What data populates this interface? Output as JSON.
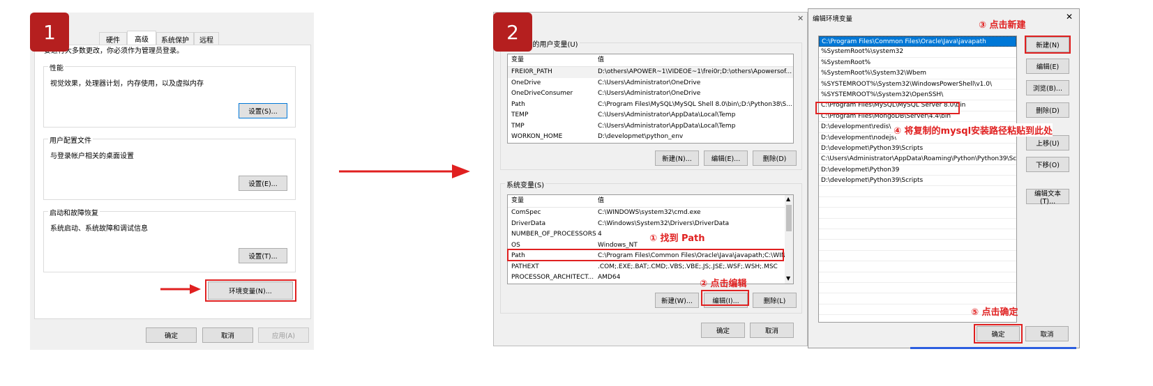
{
  "steps": {
    "step1": "1",
    "step2": "2"
  },
  "panel1": {
    "tabs": [
      "硬件",
      "高级",
      "系统保护",
      "远程"
    ],
    "intro": "要进行大多数更改，你必须作为管理员登录。",
    "performance": {
      "title": "性能",
      "desc": "视觉效果，处理器计划，内存使用，以及虚拟内存",
      "button": "设置(S)..."
    },
    "profile": {
      "title": "用户配置文件",
      "desc": "与登录帐户相关的桌面设置",
      "button": "设置(E)..."
    },
    "startup": {
      "title": "启动和故障恢复",
      "desc": "系统启动、系统故障和调试信息",
      "button": "设置(T)..."
    },
    "env_button": "环境变量(N)...",
    "ok": "确定",
    "cancel": "取消",
    "apply": "应用(A)"
  },
  "panel2": {
    "user_vars_title": "ator 的用户变量(U)",
    "col_var": "变量",
    "col_val": "值",
    "user_vars": [
      {
        "name": "FREI0R_PATH",
        "value": "D:\\others\\APOWER~1\\VIDEOE~1\\frei0r;D:\\others\\Apowersof..."
      },
      {
        "name": "OneDrive",
        "value": "C:\\Users\\Administrator\\OneDrive"
      },
      {
        "name": "OneDriveConsumer",
        "value": "C:\\Users\\Administrator\\OneDrive"
      },
      {
        "name": "Path",
        "value": "C:\\Program Files\\MySQL\\MySQL Shell 8.0\\bin\\;D:\\Python38\\S..."
      },
      {
        "name": "TEMP",
        "value": "C:\\Users\\Administrator\\AppData\\Local\\Temp"
      },
      {
        "name": "TMP",
        "value": "C:\\Users\\Administrator\\AppData\\Local\\Temp"
      },
      {
        "name": "WORKON_HOME",
        "value": "D:\\developmet\\python_env"
      }
    ],
    "user_new": "新建(N)...",
    "user_edit": "编辑(E)...",
    "user_delete": "删除(D)",
    "sys_vars_title": "系统变量(S)",
    "sys_vars": [
      {
        "name": "ComSpec",
        "value": "C:\\WINDOWS\\system32\\cmd.exe"
      },
      {
        "name": "DriverData",
        "value": "C:\\Windows\\System32\\Drivers\\DriverData"
      },
      {
        "name": "NUMBER_OF_PROCESSORS",
        "value": "4"
      },
      {
        "name": "OS",
        "value": "Windows_NT"
      },
      {
        "name": "Path",
        "value": "C:\\Program Files\\Common Files\\Oracle\\Java\\javapath;C:\\WIN..."
      },
      {
        "name": "PATHEXT",
        "value": ".COM;.EXE;.BAT;.CMD;.VBS;.VBE;.JS;.JSE;.WSF;.WSH;.MSC"
      },
      {
        "name": "PROCESSOR_ARCHITECT...",
        "value": "AMD64"
      }
    ],
    "sys_new": "新建(W)...",
    "sys_edit": "编辑(I)...",
    "sys_delete": "删除(L)",
    "ok": "确定",
    "cancel": "取消",
    "note1": "① 找到 Path",
    "note2": "② 点击编辑"
  },
  "panel3": {
    "title": "编辑环境变量",
    "close": "✕",
    "paths": [
      "C:\\Program Files\\Common Files\\Oracle\\Java\\javapath",
      "%SystemRoot%\\system32",
      "%SystemRoot%",
      "%SystemRoot%\\System32\\Wbem",
      "%SYSTEMROOT%\\System32\\WindowsPowerShell\\v1.0\\",
      "%SYSTEMROOT%\\System32\\OpenSSH\\",
      "C:\\Program Files\\MySQL\\MySQL Server 8.0\\bin",
      "C:\\Program Files\\MongoDB\\Server\\4.4\\bin",
      "D:\\development\\redis\\",
      "D:\\development\\nodejs\\",
      "D:\\developmet\\Python39\\Scripts",
      "C:\\Users\\Administrator\\AppData\\Roaming\\Python\\Python39\\Scr...",
      "D:\\developmet\\Python39",
      "D:\\developmet\\Python39\\Scripts"
    ],
    "btn_new": "新建(N)",
    "btn_edit": "编辑(E)",
    "btn_browse": "浏览(B)...",
    "btn_delete": "删除(D)",
    "btn_up": "上移(U)",
    "btn_down": "下移(O)",
    "btn_edit_text": "编辑文本(T)...",
    "ok": "确定",
    "cancel": "取消",
    "note3": "③ 点击新建",
    "note4": "④ 将复制的mysql安装路径粘贴到此处",
    "note5": "⑤ 点击确定"
  },
  "colors": {
    "highlight": "#e02020",
    "badge": "#b51f1f",
    "selection": "#0078d7"
  }
}
